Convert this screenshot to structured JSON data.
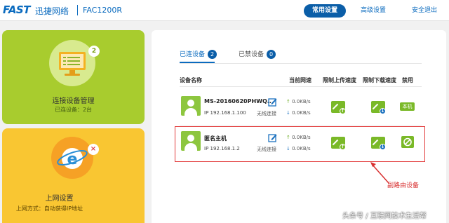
{
  "header": {
    "logo": "FAST",
    "brand_cn": "迅捷网络",
    "model": "FAC1200R",
    "nav": {
      "common": "常用设置",
      "advanced": "高级设置",
      "logout": "安全退出"
    }
  },
  "cards": {
    "device": {
      "title": "连接设备管理",
      "subtitle": "已连设备：2台",
      "badge": "2"
    },
    "internet": {
      "title": "上网设置",
      "subtitle": "上网方式：自动获得IP地址",
      "badge": "×"
    }
  },
  "panel": {
    "tabs": [
      {
        "label": "已连设备",
        "count": "2"
      },
      {
        "label": "已禁设备",
        "count": "0"
      }
    ],
    "columns": {
      "name": "设备名称",
      "speed": "当前网速",
      "up_limit": "限制上传速度",
      "down_limit": "限制下载速度",
      "block": "禁用"
    },
    "devices": [
      {
        "name": "MS-20160620PHWQ...",
        "ip": "IP 192.168.1.100",
        "conn": "无线连接",
        "up_speed": "0.0KB/s",
        "down_speed": "0.0KB/s",
        "block_label": "本机"
      },
      {
        "name": "匿名主机",
        "ip": "IP 192.168.1.2",
        "conn": "无线连接",
        "up_speed": "0.0KB/s",
        "down_speed": "0.0KB/s"
      }
    ]
  },
  "annotation": "副路由设备",
  "watermark": "头条号 / 互联网技术生活帮",
  "colors": {
    "brand_blue": "#0b6bbf",
    "green": "#7ab928",
    "card_green": "#a8cc2e",
    "card_yellow": "#f9c632",
    "highlight_red": "#e23a3a"
  }
}
